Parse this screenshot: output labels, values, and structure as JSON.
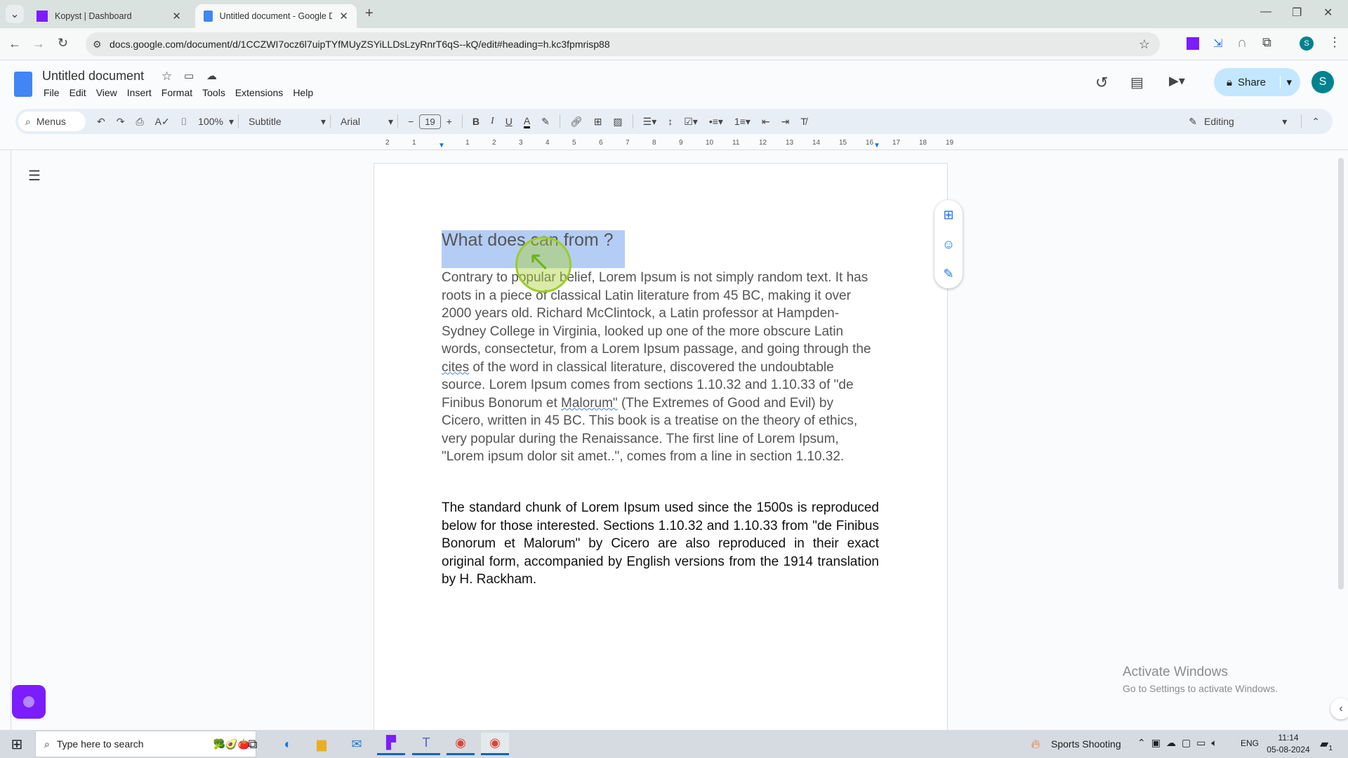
{
  "browser": {
    "tabs": [
      {
        "label": "Kopyst | Dashboard",
        "active": false
      },
      {
        "label": "Untitled document - Google Docs",
        "active": true
      }
    ],
    "url": "docs.google.com/document/d/1CCZWI7ocz6l7uipTYfMUyZSYiLLDsLzyRnrT6qS--kQ/edit#heading=h.kc3fpmrisp88",
    "profile_initial": "S"
  },
  "docs": {
    "title": "Untitled document",
    "menu": [
      "File",
      "Edit",
      "View",
      "Insert",
      "Format",
      "Tools",
      "Extensions",
      "Help"
    ],
    "share_label": "Share",
    "avatar": "S",
    "toolbar": {
      "search": "Menus",
      "zoom": "100%",
      "style": "Subtitle",
      "font": "Arial",
      "font_size": "19",
      "mode": "Editing"
    },
    "ruler": [
      "2",
      "1",
      "1",
      "2",
      "3",
      "4",
      "5",
      "6",
      "7",
      "8",
      "9",
      "10",
      "11",
      "12",
      "13",
      "14",
      "15",
      "16",
      "17",
      "18",
      "19"
    ]
  },
  "document": {
    "heading": "What does can from ?",
    "para1": [
      " Contrary to popular belief, Lorem Ipsum is not simply random text. It has roots in a piece of classical Latin literature from 45 BC, making it over 2000 years old. Richard McClintock, a Latin professor at Hampden-Sydney College in Virginia, looked up one of the more obscure Latin words, consectetur, from a Lorem Ipsum passage, and going through the ",
      "cites",
      " of the word in classical literature, discovered the undoubtable source. Lorem Ipsum comes from sections 1.10.32 and 1.10.33 of \"de Finibus Bonorum et ",
      "Malorum\"",
      " (The Extremes of Good and Evil) by Cicero, written in 45 BC. This book is a treatise on the theory of ethics, very popular during the Renaissance. The first line of Lorem Ipsum, \"Lorem ipsum dolor sit amet..\", comes from a line in section 1.10.32."
    ],
    "para2": "The standard chunk of Lorem Ipsum used since the 1500s is reproduced below for those interested. Sections 1.10.32 and 1.10.33 from \"de Finibus Bonorum et Malorum\" by Cicero are also reproduced in their exact original form, accompanied by English versions from the 1914 translation by H. Rackham."
  },
  "watermark": {
    "title": "Activate Windows",
    "subtitle": "Go to Settings to activate Windows."
  },
  "taskbar": {
    "search_placeholder": "Type here to search",
    "weather": "Sports Shooting",
    "lang": "ENG",
    "time": "11:14",
    "date": "05-08-2024",
    "notifications": "1"
  },
  "colors": {
    "selection": "#b4cdf5",
    "share_bg": "#c2e7ff",
    "avatar": "#00838f",
    "accent": "#1a73e8"
  }
}
